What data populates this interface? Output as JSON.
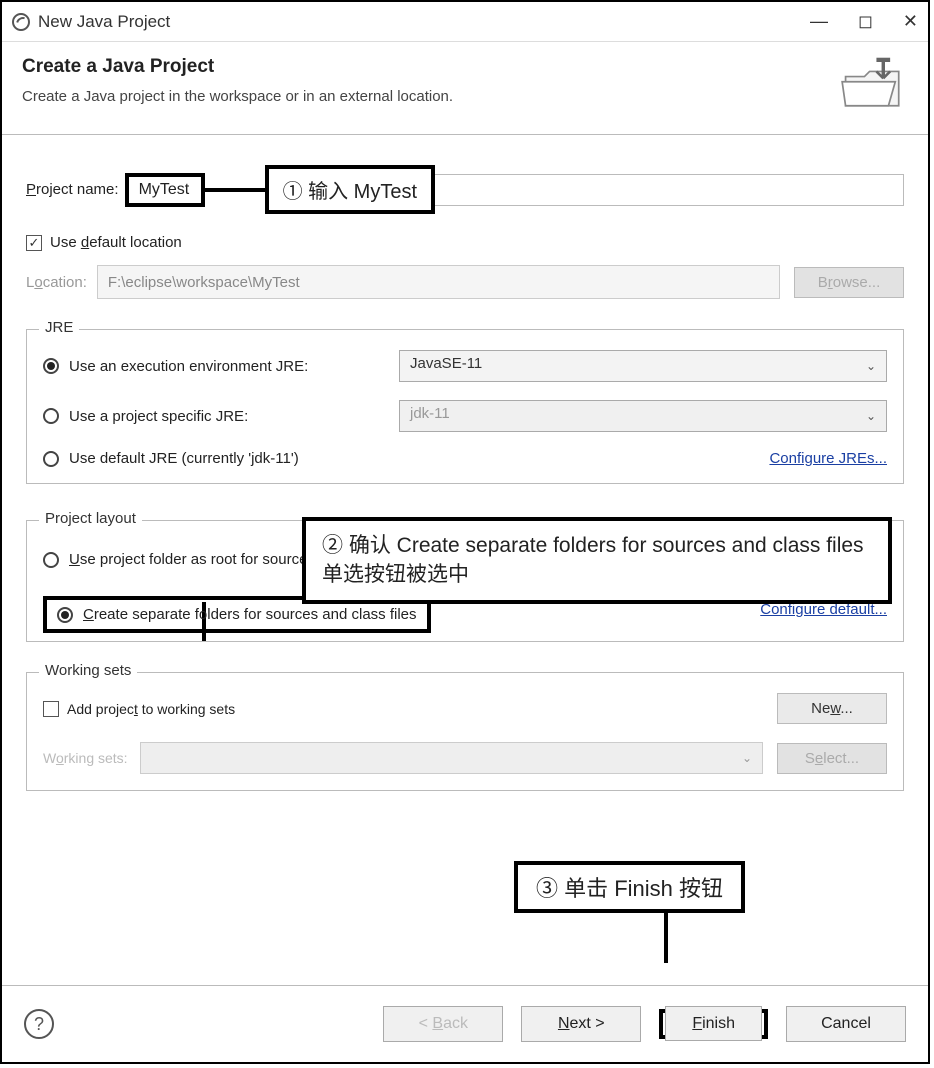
{
  "titlebar": {
    "title": "New Java Project"
  },
  "header": {
    "title": "Create a Java Project",
    "subtitle": "Create a Java project in the workspace or in an external location."
  },
  "project_name": {
    "label_pre": "P",
    "label_post": "roject name:",
    "value": "MyTest"
  },
  "annotation1": "① 输入 MyTest",
  "use_default": {
    "label_pre": "Use ",
    "label_u": "d",
    "label_post": "efault location",
    "checked": true
  },
  "location": {
    "label_pre": "L",
    "label_u": "o",
    "label_post": "cation:",
    "value": "F:\\eclipse\\workspace\\MyTest",
    "browse_pre": "B",
    "browse_u": "r",
    "browse_post": "owse..."
  },
  "jre": {
    "legend": "JRE",
    "opt1": {
      "label": "Use an execution environment JRE:",
      "selected": true,
      "value": "JavaSE-11"
    },
    "opt2": {
      "label": "Use a project specific JRE:",
      "selected": false,
      "value": "jdk-11"
    },
    "opt3": {
      "label": "Use default JRE (currently 'jdk-11')",
      "selected": false
    },
    "configure": "Configure JREs..."
  },
  "layout": {
    "legend": "Project layout",
    "opt1": {
      "label_pre": "U",
      "label_post": "se project folder as root for sources and class files",
      "selected": false
    },
    "opt2": {
      "label_pre": "C",
      "label_post": "reate separate folders for sources and class files",
      "selected": true
    },
    "configure": "Configure default..."
  },
  "annotation2": "② 确认 Create separate folders for sources and class files 单选按钮被选中",
  "working_sets": {
    "legend": "Working sets",
    "add_label_pre": "Add projec",
    "add_label_u": "t",
    "add_label_post": " to working sets",
    "checked": false,
    "new_pre": "Ne",
    "new_u": "w",
    "new_post": "...",
    "ws_label_pre": "W",
    "ws_u": "o",
    "ws_label_post": "rking sets:",
    "select_pre": "S",
    "select_u": "e",
    "select_post": "lect..."
  },
  "annotation3": "③ 单击 Finish 按钮",
  "footer": {
    "back_pre": "< ",
    "back_u": "B",
    "back_post": "ack",
    "next_pre": "",
    "next_u": "N",
    "next_post": "ext >",
    "finish_pre": "",
    "finish_u": "F",
    "finish_post": "inish",
    "cancel": "Cancel"
  }
}
